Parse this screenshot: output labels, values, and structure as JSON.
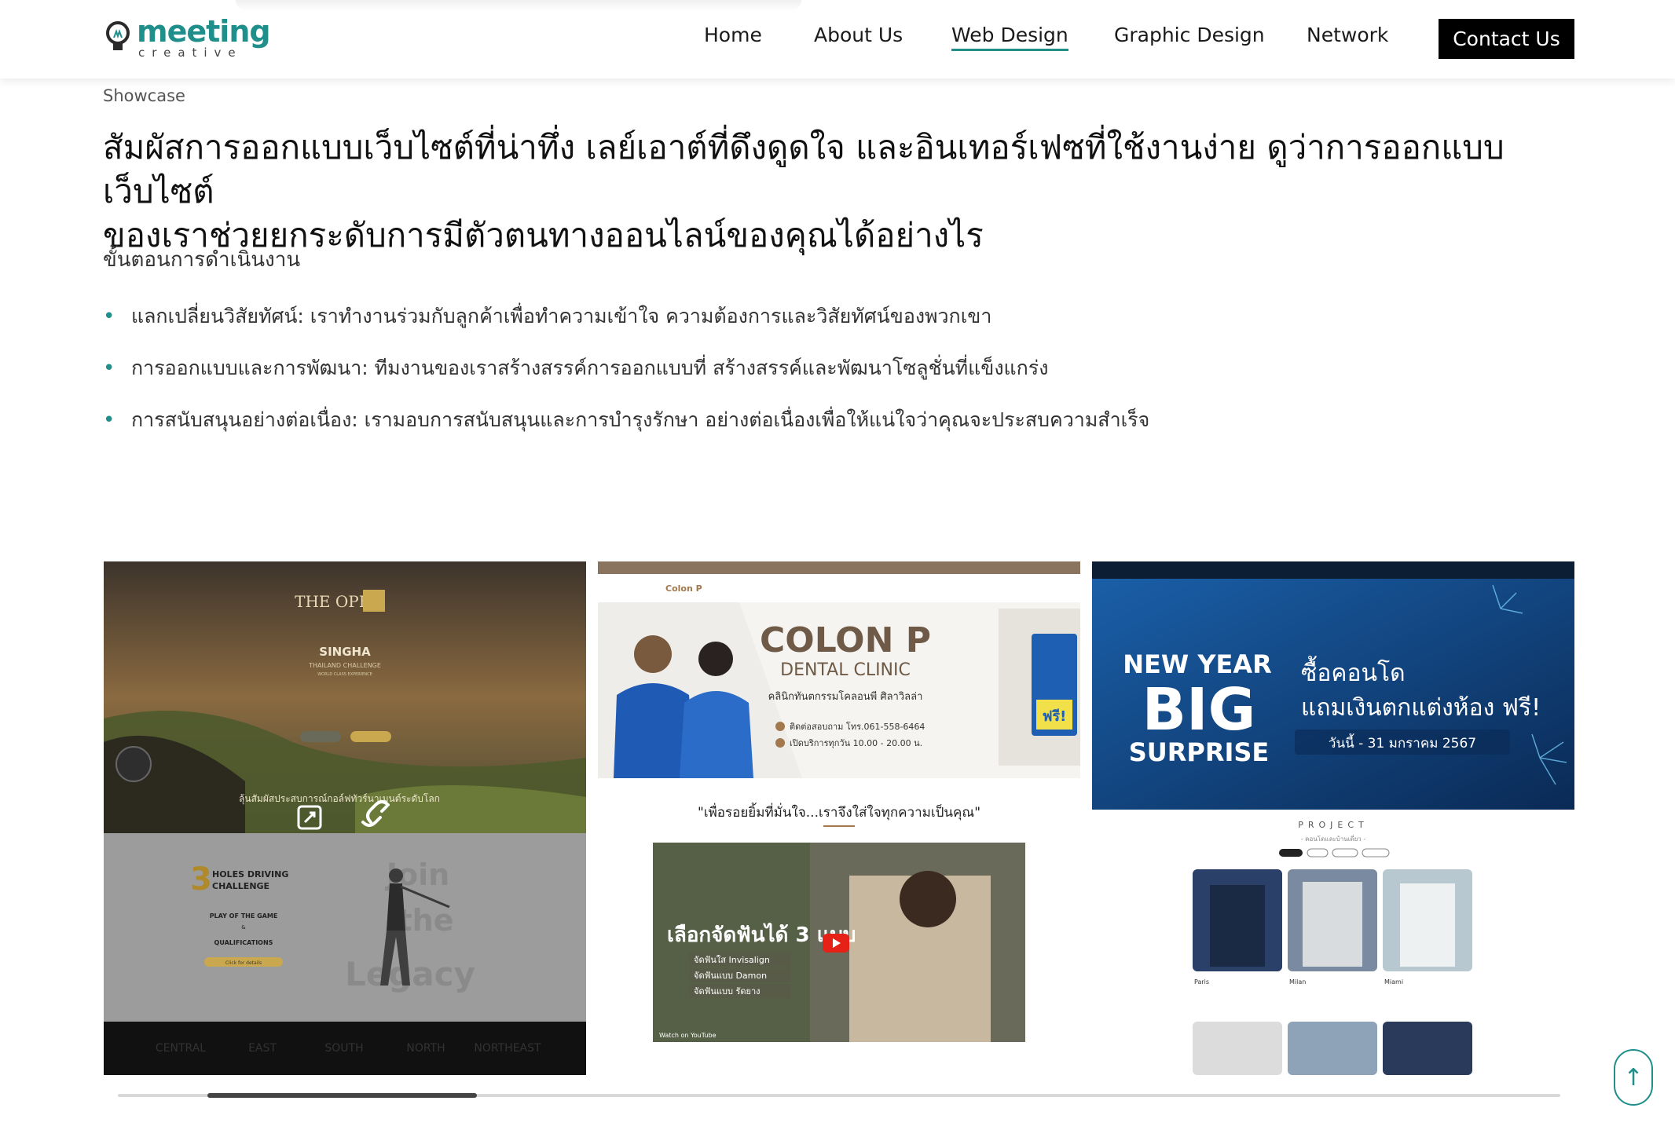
{
  "logo": {
    "name": "meeting",
    "sub": "creative"
  },
  "nav": {
    "items": [
      {
        "label": "Home"
      },
      {
        "label": "About Us"
      },
      {
        "label": "Web Design"
      },
      {
        "label": "Graphic Design"
      },
      {
        "label": "Network"
      }
    ],
    "active_index": 2,
    "contact_label": "Contact Us"
  },
  "breadcrumb": "Showcase",
  "heading": {
    "line1": "สัมผัสการออกแบบเว็บไซต์ที่น่าทึ่ง เลย์เอาต์ที่ดึงดูดใจ และอินเทอร์เฟซที่ใช้งานง่าย ดูว่าการออกแบบเว็บไซต์",
    "line2": "ของเราช่วยยกระดับการมีตัวตนทางออนไลน์ของคุณได้อย่างไร"
  },
  "process_title": "ขั้นตอนการดำเนินงาน",
  "bullets": [
    "แลกเปลี่ยนวิสัยทัศน์: เราทำงานร่วมกับลูกค้าเพื่อทำความเข้าใจ ความต้องการและวิสัยทัศน์ของพวกเขา",
    "การออกแบบและการพัฒนา: ทีมงานของเราสร้างสรรค์การออกแบบที่ สร้างสรรค์และพัฒนาโซลูชั่นที่แข็งแกร่ง",
    "การสนับสนุนอย่างต่อเนื่อง: เรามอบการสนับสนุนและการบำรุงรักษา อย่างต่อเนื่องเพื่อให้แน่ใจว่าคุณจะประสบความสำเร็จ"
  ],
  "cards": {
    "singha": {
      "brand": "THE OPEN",
      "title": "SINGHA",
      "subtitle": "THAILAND CHALLENGE",
      "tagline": "WORLD CLASS EXPERIENCE",
      "caption": "ลุ้นสัมผัสประสบการณ์กอล์ฟทัวร์นาเมนต์ระดับโลก",
      "section_number": "3",
      "section_title_1": "HOLES DRIVING",
      "section_title_2": "CHALLENGE",
      "play": "PLAY OF THE GAME",
      "amp": "&",
      "qual": "QUALIFICATIONS",
      "click": "Click for details",
      "legacy_1": "Join",
      "legacy_2": "the",
      "legacy_3": "Legacy",
      "regions": [
        "CENTRAL",
        "EAST",
        "SOUTH",
        "NORTH",
        "NORTHEAST"
      ]
    },
    "colonp": {
      "brand": "Colon P",
      "title": "COLON P",
      "subtitle": "DENTAL CLINIC",
      "desc": "คลินิกทันตกรรมโคลอนพี ศิลาวิลล่า",
      "phone": "ติดต่อสอบถาม โทร.061-558-6464",
      "hours": "เปิดบริการทุกวัน 10.00 - 20.00 น.",
      "badge": "ฟรี!",
      "quote": "\"เพื่อรอยยิ้มที่มั่นใจ...เราจึงใส่ใจทุกความเป็นคุณ\"",
      "video_title": "เลือกจัดฟันได้ 3 แบบ",
      "video_opt1": "จัดฟันใส Invisalign",
      "video_opt2": "จัดฟันแบบ Damon",
      "video_opt3": "จัดฟันแบบ รัดยาง",
      "watch": "Watch on YouTube"
    },
    "condo": {
      "line1": "NEW YEAR",
      "line2": "BIG",
      "line3": "SURPRISE",
      "promo1": "ซื้อคอนโด",
      "promo2": "แถมเงินตกแต่งห้อง ฟรี!",
      "promo3": "วันนี้ - 31 มกราคม 2567",
      "section": "PROJECT",
      "section_sub": "- คอนโดและบ้านเดี่ยว -",
      "projects": [
        "Paris",
        "Milan",
        "Miami"
      ]
    }
  },
  "colors": {
    "accent": "#1f8f8b",
    "button_bg": "#000000"
  }
}
